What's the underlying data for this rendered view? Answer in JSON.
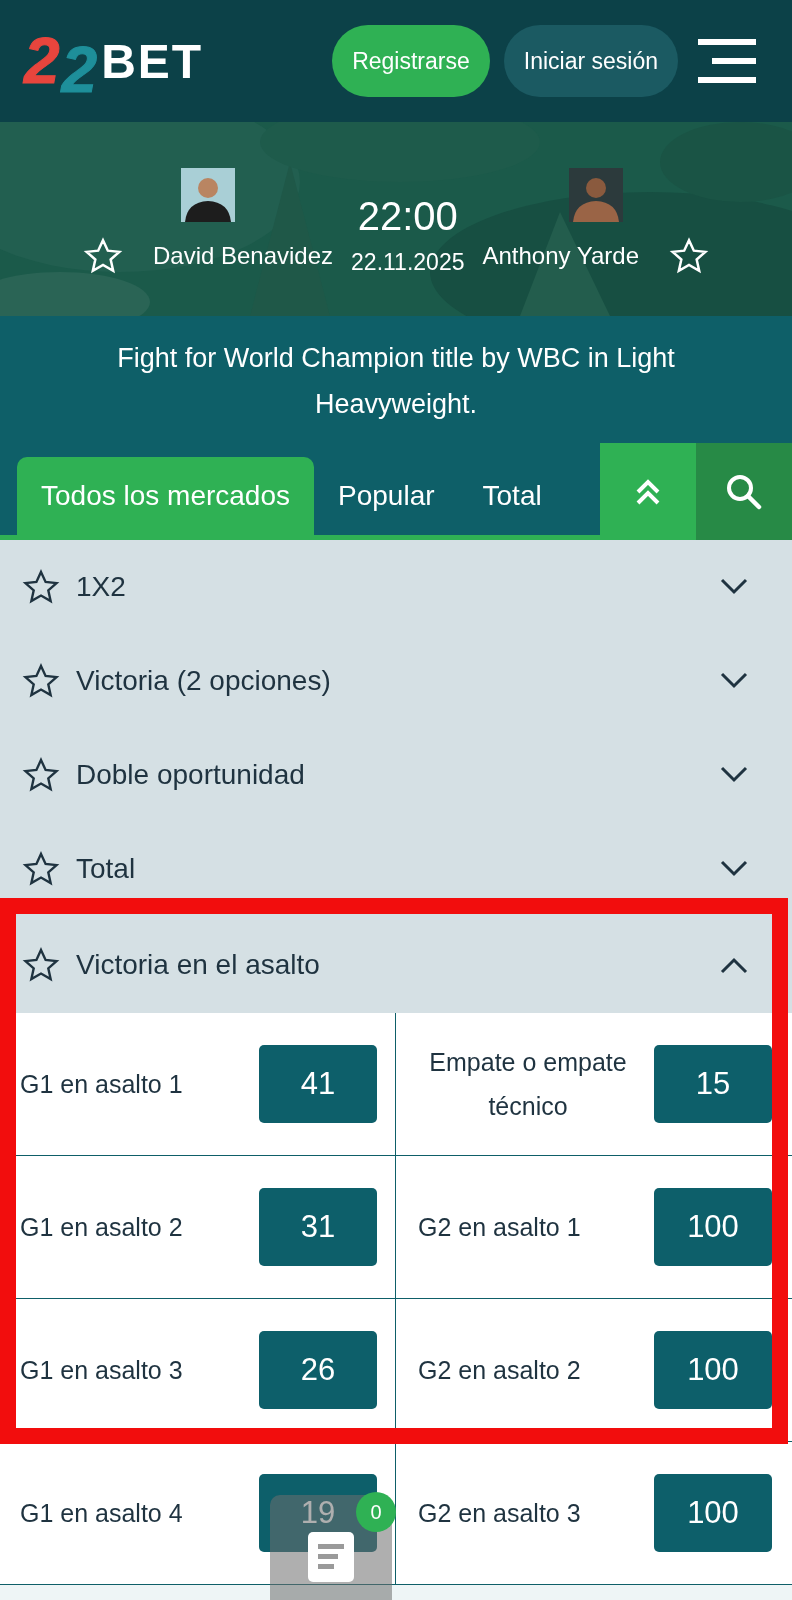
{
  "header": {
    "logo": {
      "digits": [
        "2",
        "2"
      ],
      "word": "BET"
    },
    "buttons": [
      {
        "label": "Registrarse",
        "kind": "primary"
      },
      {
        "label": "Iniciar sesión",
        "kind": "secondary"
      }
    ]
  },
  "event": {
    "time": "22:00",
    "date": "22.11.2025",
    "fighters": [
      {
        "name": "David Benavidez",
        "favorite": false
      },
      {
        "name": "Anthony Yarde",
        "favorite": false
      }
    ],
    "description": "Fight for World Champion title by WBC in Light Heavyweight."
  },
  "tabs": [
    {
      "label": "Todos los mercados",
      "selected": true
    },
    {
      "label": "Popular",
      "selected": false
    },
    {
      "label": "Total",
      "selected": false
    }
  ],
  "markets": [
    {
      "name": "1X2",
      "favorite": false,
      "expanded": false
    },
    {
      "name": "Victoria (2 opciones)",
      "favorite": false,
      "expanded": false
    },
    {
      "name": "Doble oportunidad",
      "favorite": false,
      "expanded": false
    },
    {
      "name": "Total",
      "favorite": false,
      "expanded": false
    },
    {
      "name": "Victoria en el asalto",
      "favorite": false,
      "expanded": true,
      "highlighted": true,
      "rows": [
        {
          "highlighted": true,
          "outcomes": [
            {
              "label": "G1 en asalto 1",
              "odds": "41"
            },
            {
              "label": "Empate o empate técnico",
              "odds": "15"
            }
          ]
        },
        {
          "highlighted": true,
          "outcomes": [
            {
              "label": "G1 en asalto 2",
              "odds": "31"
            },
            {
              "label": "G2 en asalto 1",
              "odds": "100"
            }
          ]
        },
        {
          "highlighted": true,
          "outcomes": [
            {
              "label": "G1 en asalto 3",
              "odds": "26"
            },
            {
              "label": "G2 en asalto 2",
              "odds": "100"
            }
          ]
        },
        {
          "highlighted": false,
          "outcomes": [
            {
              "label": "G1 en asalto 4",
              "odds": "19"
            },
            {
              "label": "G2 en asalto 3",
              "odds": "100"
            }
          ]
        }
      ]
    }
  ],
  "bet_slip": {
    "count": "0"
  }
}
